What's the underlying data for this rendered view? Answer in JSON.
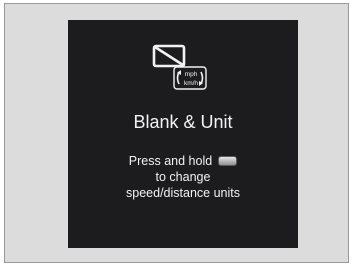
{
  "display": {
    "blank_icon": "blank-screen-icon",
    "unit_icon": "unit-toggle-icon",
    "unit_icon_top": "mph",
    "unit_icon_bottom": "km/h",
    "title": "Blank & Unit",
    "line1": "Press and hold",
    "line2": "to change",
    "line3": "speed/distance units",
    "button_icon": "steering-button-icon"
  },
  "colors": {
    "screen_bg": "#1c1c1e",
    "frame_bg": "#dcdcdc",
    "text": "#f2f2f2"
  }
}
